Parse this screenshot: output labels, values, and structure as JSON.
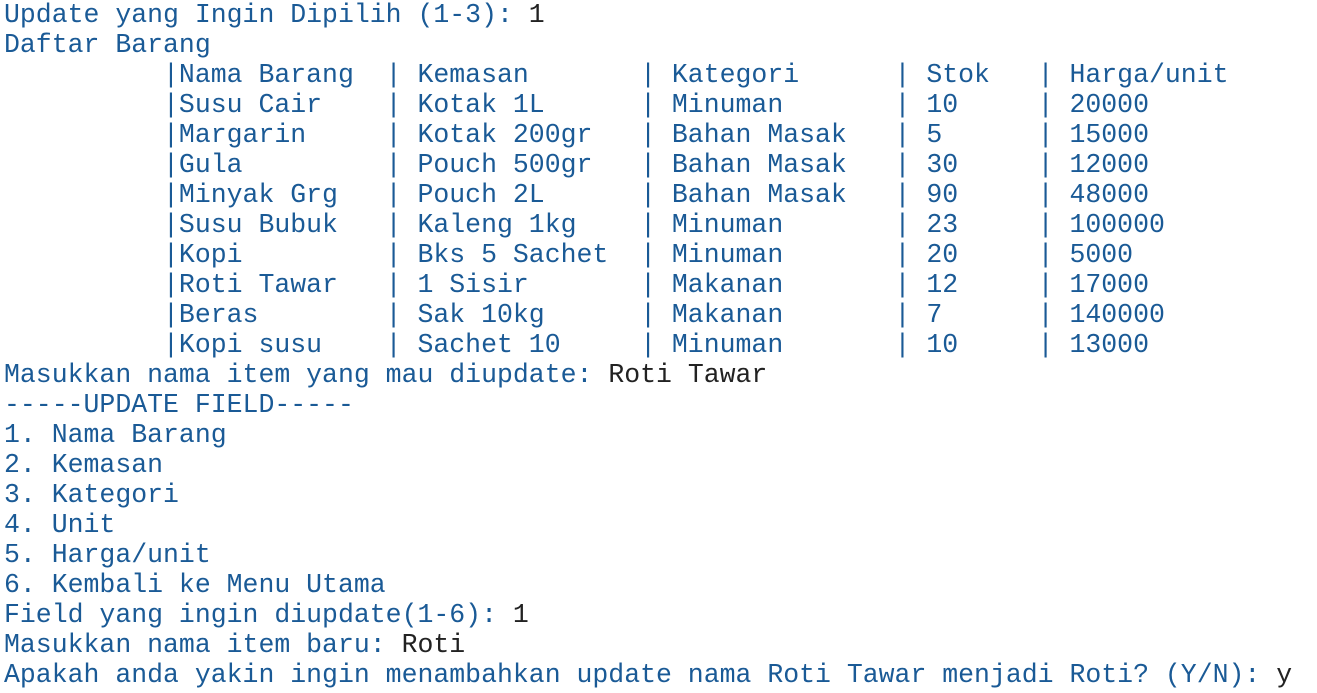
{
  "colors": {
    "prompt_text": "#1a5a96",
    "user_input": "#222222",
    "background": "#ffffff"
  },
  "update_choice": {
    "prompt": "Update yang Ingin Dipilih (1-3): ",
    "input": "1"
  },
  "list_title": "Daftar Barang",
  "table": {
    "header": "          |Nama Barang  | Kemasan       | Kategori      | Stok   | Harga/unit",
    "rows": [
      "          |Susu Cair    | Kotak 1L      | Minuman       | 10     | 20000",
      "          |Margarin     | Kotak 200gr   | Bahan Masak   | 5      | 15000",
      "          |Gula         | Pouch 500gr   | Bahan Masak   | 30     | 12000",
      "          |Minyak Grg   | Pouch 2L      | Bahan Masak   | 90     | 48000",
      "          |Susu Bubuk   | Kaleng 1kg    | Minuman       | 23     | 100000",
      "          |Kopi         | Bks 5 Sachet  | Minuman       | 20     | 5000",
      "          |Roti Tawar   | 1 Sisir       | Makanan       | 12     | 17000",
      "          |Beras        | Sak 10kg      | Makanan       | 7      | 140000",
      "          |Kopi susu    | Sachet 10     | Minuman       | 10     | 13000"
    ]
  },
  "item_select": {
    "prompt": "Masukkan nama item yang mau diupdate: ",
    "input": "Roti Tawar"
  },
  "update_field_title": "-----UPDATE FIELD-----",
  "menu_items": [
    "1. Nama Barang",
    "2. Kemasan",
    "3. Kategori",
    "4. Unit",
    "5. Harga/unit",
    "6. Kembali ke Menu Utama"
  ],
  "field_choice": {
    "prompt": "Field yang ingin diupdate(1-6): ",
    "input": "1"
  },
  "new_name": {
    "prompt": "Masukkan nama item baru: ",
    "input": "Roti"
  },
  "confirm": {
    "prompt": "Apakah anda yakin ingin menambahkan update nama Roti Tawar menjadi Roti? (Y/N): ",
    "input": "y"
  }
}
